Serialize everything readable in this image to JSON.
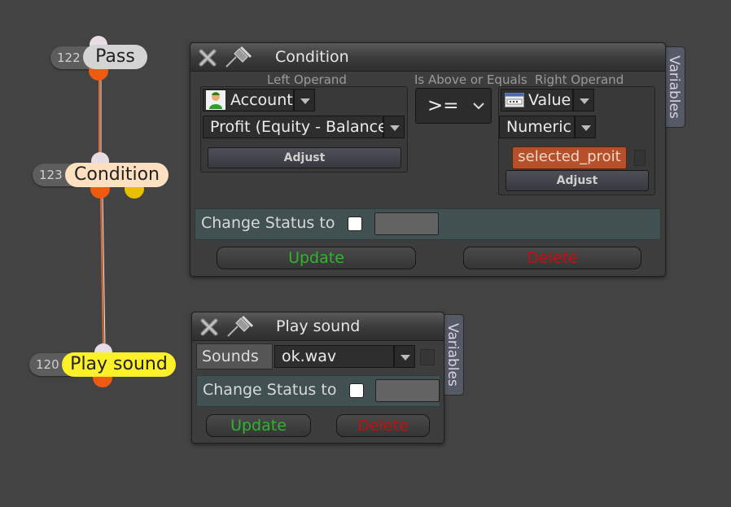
{
  "flow_nodes": [
    {
      "id": "122",
      "label": "Pass"
    },
    {
      "id": "123",
      "label": "Condition"
    },
    {
      "id": "120",
      "label": "Play sound"
    }
  ],
  "condition_panel": {
    "title": "Condition",
    "variables_tab": "Variables",
    "left_operand_caption": "Left Operand",
    "operator_caption": "Is Above or Equals",
    "right_operand_caption": "Right Operand",
    "left_source": "Account",
    "left_field": "Profit (Equity - Balance)",
    "left_adjust": "Adjust",
    "operator_value": ">=",
    "right_source": "Value",
    "right_type": "Numeric",
    "right_variable": "selected_proit",
    "right_adjust": "Adjust",
    "change_status_label": "Change Status to",
    "update_label": "Update",
    "delete_label": "Delete"
  },
  "sound_panel": {
    "title": "Play sound",
    "variables_tab": "Variables",
    "sounds_label": "Sounds",
    "sound_value": "ok.wav",
    "change_status_label": "Change Status to",
    "update_label": "Update",
    "delete_label": "Delete"
  },
  "colors": {
    "background": "#434343",
    "connector_out": "#ee5a12",
    "connector_in": "#e8dde4",
    "condition_node": "#fde0c0",
    "play_sound_node": "#fbf02a",
    "pass_node": "#d4d4d4",
    "update_text": "#2fb52f",
    "delete_text": "#c21010",
    "variable_chip": "#b5502a"
  },
  "icons": [
    "close-icon",
    "pin-icon",
    "user-icon",
    "value-icon",
    "chevron-down-icon"
  ]
}
